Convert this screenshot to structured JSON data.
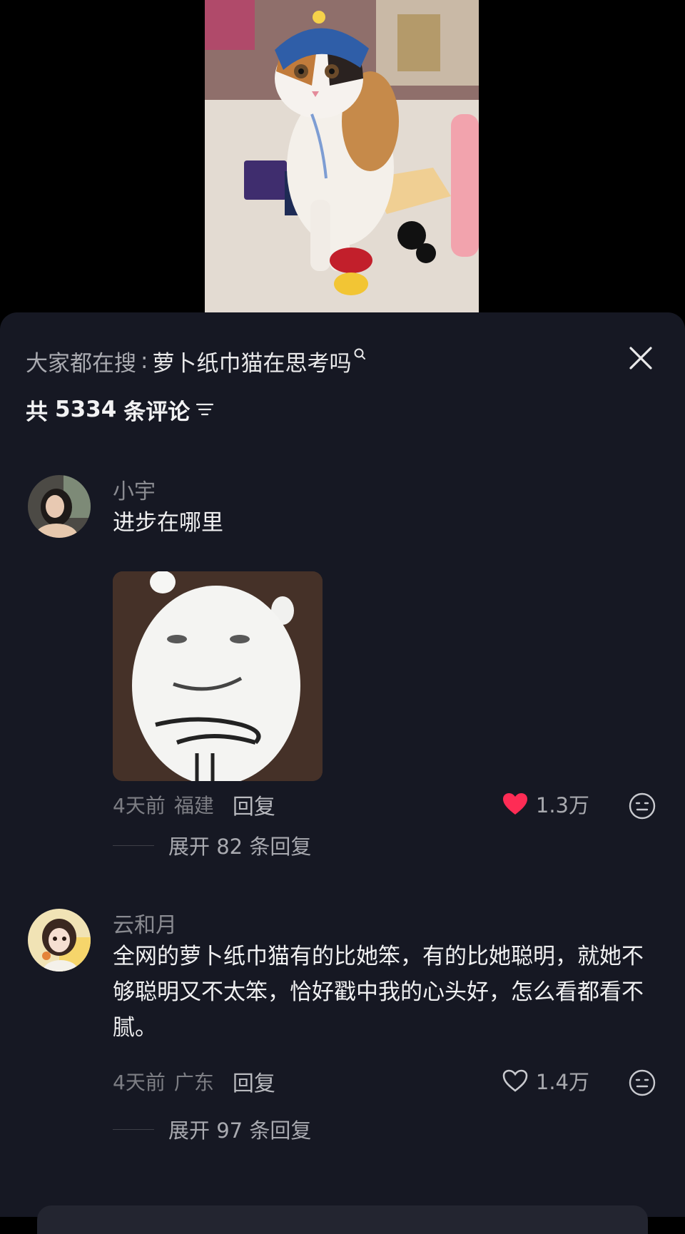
{
  "search": {
    "prefix": "大家都在搜",
    "separator": ":",
    "query": "萝卜纸巾猫在思考吗"
  },
  "comments_header": {
    "prefix": "共",
    "count": "5334",
    "suffix": "条评论"
  },
  "comments": [
    {
      "username": "小宇",
      "text": "进步在哪里",
      "has_sticker": true,
      "time": "4天前",
      "location": "福建",
      "reply_label": "回复",
      "likes": "1.3万",
      "liked": true,
      "expand_label": "展开 82 条回复"
    },
    {
      "username": "云和月",
      "text": "全网的萝卜纸巾猫有的比她笨，有的比她聪明，就她不够聪明又不太笨，恰好戳中我的心头好，怎么看都看不腻。",
      "has_sticker": false,
      "time": "4天前",
      "location": "广东",
      "reply_label": "回复",
      "likes": "1.4万",
      "liked": false,
      "expand_label": "展开 97 条回复"
    }
  ],
  "colors": {
    "sheet_bg": "#161823",
    "like_red": "#fe2c55",
    "secondary_text": "#8a8b91"
  }
}
